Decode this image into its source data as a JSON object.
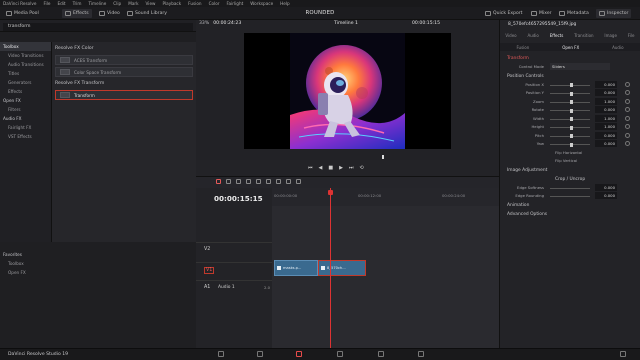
{
  "menubar": {
    "items": [
      "DaVinci Resolve",
      "File",
      "Edit",
      "Trim",
      "Timeline",
      "Clip",
      "Mark",
      "View",
      "Playback",
      "Fusion",
      "Color",
      "Fairlight",
      "Workspace",
      "Help"
    ]
  },
  "toolbar": {
    "media_pool": "Media Pool",
    "effects": "Effects",
    "video": "Video",
    "sound_library": "Sound Library",
    "project_title": "ROUNDED",
    "quick_export": "Quick Export",
    "mixer": "Mixer",
    "metadata": "Metadata",
    "inspector": "Inspector"
  },
  "effects_panel": {
    "search_value": "transform",
    "tree": [
      {
        "label": "Toolbox",
        "top": true,
        "sel": true
      },
      {
        "label": "Video Transitions"
      },
      {
        "label": "Audio Transitions"
      },
      {
        "label": "Titles"
      },
      {
        "label": "Generators"
      },
      {
        "label": "Effects"
      },
      {
        "label": "Open FX",
        "top": true
      },
      {
        "label": "Filters"
      },
      {
        "label": "Audio FX",
        "top": true
      },
      {
        "label": "Fairlight FX"
      },
      {
        "label": "VST Effects"
      }
    ],
    "groups": [
      {
        "title": "Resolve FX Color",
        "items": [
          {
            "label": "ACES Transform"
          },
          {
            "label": "Color Space Transform"
          }
        ]
      },
      {
        "title": "Resolve FX Transform",
        "items": [
          {
            "label": "Transform",
            "sel": true
          }
        ]
      }
    ],
    "favorites_title": "Favorites",
    "favorites": [
      "Toolbox",
      "Open FX"
    ]
  },
  "viewer": {
    "zoom": "33%",
    "source_tc": "00:00:24:23",
    "timeline_name": "Timeline 1",
    "record_tc": "00:00:15:15"
  },
  "timeline": {
    "timecode": "00:00:15:15",
    "ruler": [
      "00:00:00:00",
      "00:00:12:00",
      "00:00:24:00"
    ],
    "tracks": [
      {
        "id": "V2",
        "name": ""
      },
      {
        "id": "V1",
        "name": ""
      },
      {
        "id": "A1",
        "name": "Audio 1",
        "extra": "2.0"
      }
    ],
    "clips": [
      {
        "label": "masks.p..."
      },
      {
        "label": "8_570ch..."
      }
    ]
  },
  "inspector": {
    "file": "8_570efc4657295549_15f9.jpg",
    "tabs": [
      "Video",
      "Audio",
      "Effects",
      "Transition",
      "Image",
      "File"
    ],
    "subtabs": [
      "Fusion",
      "Open FX",
      "Audio"
    ],
    "section": "Transform",
    "composite_label": "Control Mode",
    "composite_value": "Sliders",
    "position_controls": "Position Controls",
    "params": [
      {
        "label": "Position X",
        "value": "0.000"
      },
      {
        "label": "Position Y",
        "value": "0.000"
      },
      {
        "label": "Zoom",
        "value": "1.000"
      },
      {
        "label": "Rotate",
        "value": "0.000"
      },
      {
        "label": "Width",
        "value": "1.000"
      },
      {
        "label": "Height",
        "value": "1.000"
      },
      {
        "label": "Pitch",
        "value": "0.000"
      },
      {
        "label": "Yaw",
        "value": "0.000"
      }
    ],
    "flip_h": "Flip Horizontal",
    "flip_v": "Flip Vertical",
    "image_adjustment": "Image Adjustment",
    "crop": "Crop / Uncrop",
    "edge_softness": {
      "label": "Edge Softness",
      "value": "0.000"
    },
    "edge_rounding": {
      "label": "Edge Rounding",
      "value": "0.000"
    },
    "animation": "Animation",
    "advanced": "Advanced Options"
  },
  "statusbar": {
    "app": "DaVinci Resolve Studio 19"
  }
}
